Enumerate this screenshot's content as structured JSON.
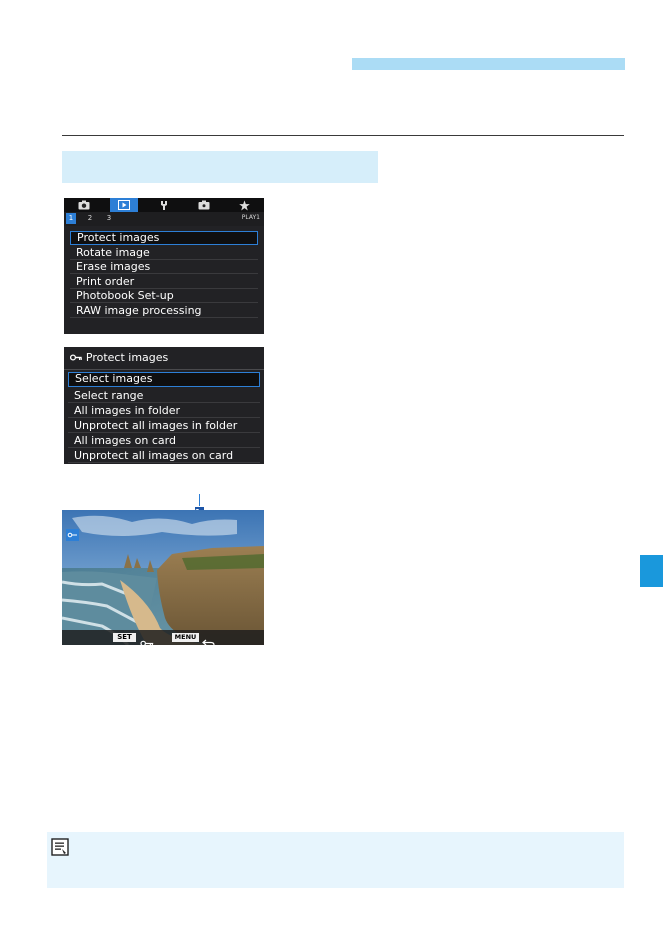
{
  "menu1": {
    "tabs": [
      {
        "icon": "camera-icon",
        "active": false
      },
      {
        "icon": "playback-icon",
        "active": true
      },
      {
        "icon": "wrench-icon",
        "active": false
      },
      {
        "icon": "custom-function-icon",
        "active": false
      },
      {
        "icon": "star-icon",
        "active": false
      }
    ],
    "pages": [
      "1",
      "2",
      "3"
    ],
    "page_label": "PLAY1",
    "items": [
      "Protect images",
      "Rotate image",
      "Erase images",
      "Print order",
      "Photobook Set-up",
      "RAW image processing"
    ]
  },
  "menu2": {
    "title": "Protect images",
    "items": [
      "Select images",
      "Select range",
      "All images in folder",
      "Unprotect all images in folder",
      "All images on card",
      "Unprotect all images on card"
    ]
  },
  "photo": {
    "set_label": "SET",
    "menu_label": "MENU"
  },
  "colors": {
    "accent_blue": "#2d7fd6",
    "header_bar": "#abdcf5",
    "section_box": "#d6eefa",
    "side_tab": "#1a98dc",
    "note_box": "#e7f5fd"
  }
}
